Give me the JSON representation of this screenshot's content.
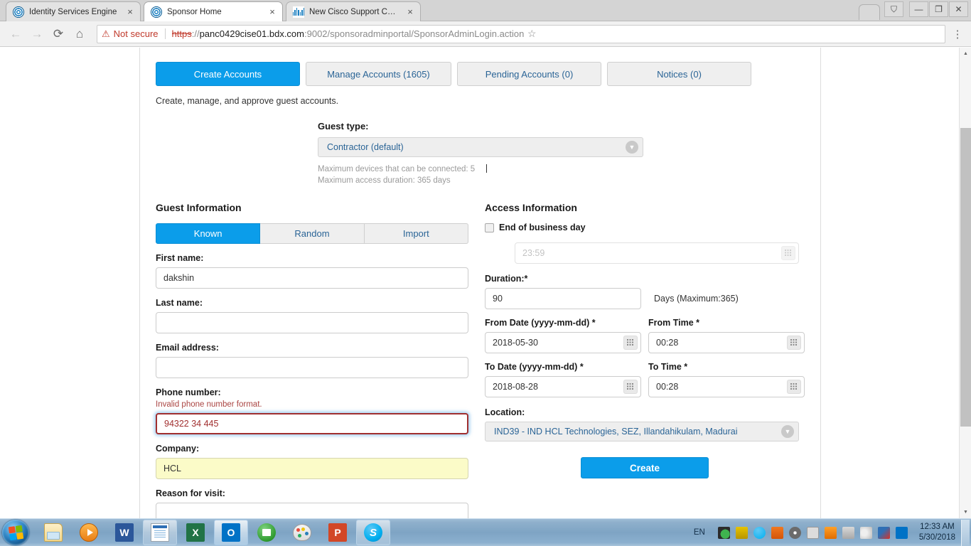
{
  "browser": {
    "tabs": [
      {
        "title": "Identity Services Engine",
        "icon": "ise-globe-icon",
        "active": false,
        "close_label": "×"
      },
      {
        "title": "Sponsor Home",
        "icon": "ise-globe-icon",
        "active": true,
        "close_label": "×"
      },
      {
        "title": "New Cisco Support Case",
        "icon": "cisco-logo-icon",
        "active": false,
        "close_label": "×"
      }
    ],
    "new_tab_label": "",
    "window_controls": {
      "user": "⛉",
      "minimize": "—",
      "maximize": "❐",
      "close": "✕"
    },
    "nav": {
      "back": "←",
      "forward": "→",
      "reload": "⟳",
      "home": "⌂"
    },
    "omnibox": {
      "security_warning_icon": "⚠",
      "security_label": "Not secure",
      "url_scheme": "https",
      "url_separator": "://",
      "url_host": "panc0429cise01.bdx.com",
      "url_path": ":9002/sponsoradminportal/SponsorAdminLogin.action",
      "bookmark_icon": "☆",
      "menu_icon": "⋮"
    }
  },
  "app": {
    "tabs": [
      {
        "label": "Create Accounts",
        "active": true
      },
      {
        "label": "Manage Accounts (1605)",
        "active": false
      },
      {
        "label": "Pending Accounts (0)",
        "active": false
      },
      {
        "label": "Notices (0)",
        "active": false
      }
    ],
    "subtitle": "Create, manage, and approve guest accounts.",
    "guest_type": {
      "label": "Guest type:",
      "value": "Contractor (default)",
      "hint_devices": "Maximum devices that can be connected: 5",
      "hint_duration": "Maximum access duration: 365 days"
    },
    "guest_information": {
      "heading": "Guest Information",
      "mode_tabs": [
        {
          "label": "Known",
          "active": true
        },
        {
          "label": "Random",
          "active": false
        },
        {
          "label": "Import",
          "active": false
        }
      ],
      "fields": {
        "first_name": {
          "label": "First name:",
          "value": "dakshin",
          "placeholder": ""
        },
        "last_name": {
          "label": "Last name:",
          "value": "",
          "placeholder": ""
        },
        "email_address": {
          "label": "Email address:",
          "value": "",
          "placeholder": ""
        },
        "phone_number": {
          "label": "Phone number:",
          "value": "94322 34 445",
          "placeholder": "",
          "error": "Invalid phone number format."
        },
        "company": {
          "label": "Company:",
          "value": "HCL",
          "placeholder": ""
        },
        "reason_for_visit": {
          "label": "Reason for visit:",
          "value": "",
          "placeholder": ""
        }
      }
    },
    "access_information": {
      "heading": "Access Information",
      "end_of_business_day": {
        "label": "End of business day",
        "checked": false
      },
      "eobd_time": {
        "value": "23:59",
        "icon": "calendar-grid-icon"
      },
      "duration": {
        "label": "Duration:*",
        "value": "90",
        "note": "Days (Maximum:365)"
      },
      "from_date": {
        "label": "From Date (yyyy-mm-dd) *",
        "value": "2018-05-30",
        "icon": "calendar-grid-icon"
      },
      "from_time": {
        "label": "From Time *",
        "value": "00:28",
        "icon": "calendar-grid-icon"
      },
      "to_date": {
        "label": "To Date (yyyy-mm-dd) *",
        "value": "2018-08-28",
        "icon": "calendar-grid-icon"
      },
      "to_time": {
        "label": "To Time *",
        "value": "00:28",
        "icon": "calendar-grid-icon"
      },
      "location": {
        "label": "Location:",
        "value": "IND39 - IND HCL Technologies, SEZ, Illandahikulam, Madurai"
      },
      "create_button": "Create"
    }
  },
  "taskbar": {
    "start_label": "",
    "items": [
      {
        "name": "explorer",
        "icon": "folder-icon",
        "state": "pinned"
      },
      {
        "name": "media-player",
        "icon": "media-player-icon",
        "state": "pinned"
      },
      {
        "name": "word",
        "icon": "word-icon",
        "glyph": "W",
        "state": "pinned"
      },
      {
        "name": "document-window",
        "icon": "document-icon",
        "state": "open"
      },
      {
        "name": "excel",
        "icon": "excel-icon",
        "glyph": "X",
        "state": "pinned"
      },
      {
        "name": "outlook",
        "icon": "outlook-icon",
        "glyph": "O",
        "state": "selected"
      },
      {
        "name": "webex",
        "icon": "webex-icon",
        "state": "pinned"
      },
      {
        "name": "paint",
        "icon": "paint-icon",
        "state": "pinned"
      },
      {
        "name": "powerpoint",
        "icon": "powerpoint-icon",
        "glyph": "P",
        "state": "pinned"
      },
      {
        "name": "skype",
        "icon": "skype-icon",
        "glyph": "S",
        "state": "open"
      }
    ],
    "tray": {
      "language": "EN",
      "icons": [
        "network-shield-icon",
        "security-icon",
        "skype-tray-icon",
        "java-icon",
        "cd-burner-icon",
        "vmware-icon",
        "shield-update-icon",
        "network-icon",
        "volume-icon",
        "pen-tablet-icon",
        "outlook-tray-icon"
      ]
    },
    "clock": {
      "time": "12:33 AM",
      "date": "5/30/2018"
    }
  },
  "colors": {
    "accent": "#0b9dea",
    "error": "#a94442",
    "link": "#2a6496",
    "autofill": "#fbfbc8"
  }
}
